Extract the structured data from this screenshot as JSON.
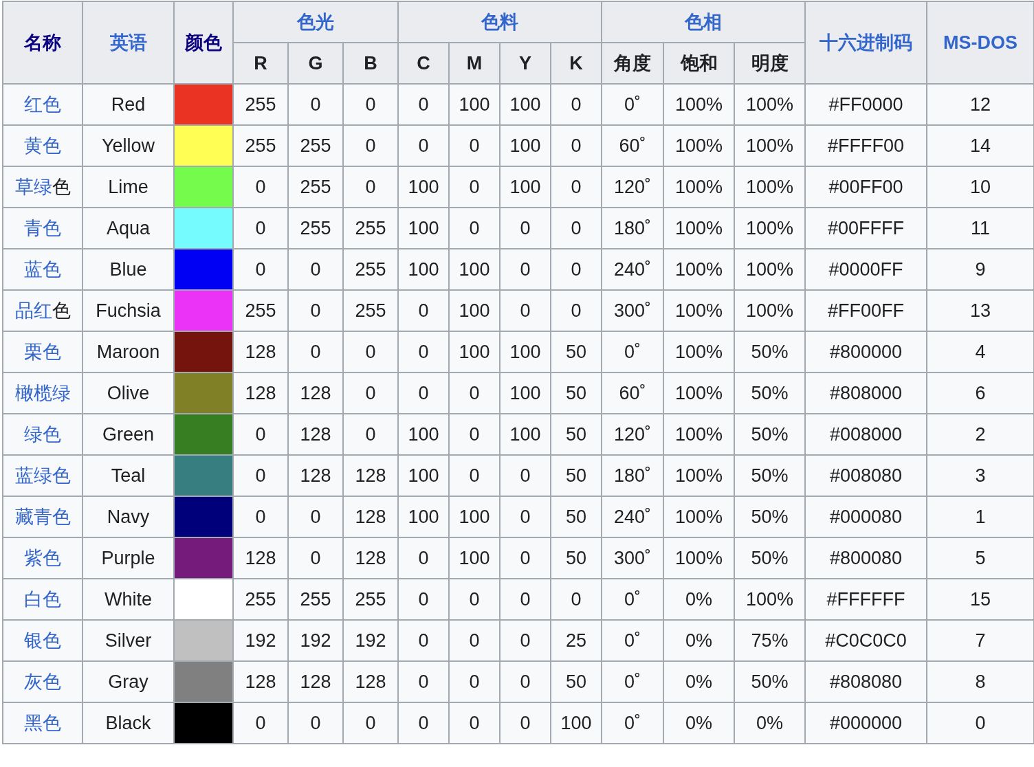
{
  "table": {
    "lead_columns": [
      {
        "label": "名称",
        "visited": true
      },
      {
        "label": "英语",
        "visited": false
      },
      {
        "label": "颜色",
        "visited": true
      }
    ],
    "groups": [
      {
        "label": "色光",
        "visited": false,
        "columns": [
          "R",
          "G",
          "B"
        ]
      },
      {
        "label": "色料",
        "visited": false,
        "columns": [
          "C",
          "M",
          "Y",
          "K"
        ]
      },
      {
        "label": "色相",
        "visited": false,
        "columns": [
          "角度",
          "饱和",
          "明度"
        ]
      }
    ],
    "trail_columns": [
      {
        "label": "十六进制码",
        "visited": false
      },
      {
        "label": "MS-DOS",
        "visited": false
      }
    ],
    "rows": [
      {
        "name_link": "红色",
        "english": "Red",
        "color": "#ea3323",
        "values": [
          "255",
          "0",
          "0",
          "0",
          "100",
          "100",
          "0",
          "0˚",
          "100%",
          "100%",
          "#FF0000",
          "12"
        ]
      },
      {
        "name_link": "黄色",
        "english": "Yellow",
        "color": "#fffe54",
        "values": [
          "255",
          "255",
          "0",
          "0",
          "0",
          "100",
          "0",
          "60˚",
          "100%",
          "100%",
          "#FFFF00",
          "14"
        ]
      },
      {
        "name_link": "草绿",
        "name_suffix": "色",
        "english": "Lime",
        "color": "#75fb4c",
        "values": [
          "0",
          "255",
          "0",
          "100",
          "0",
          "100",
          "0",
          "120˚",
          "100%",
          "100%",
          "#00FF00",
          "10"
        ]
      },
      {
        "name_link": "青色",
        "english": "Aqua",
        "color": "#75fbfd",
        "values": [
          "0",
          "255",
          "255",
          "100",
          "0",
          "0",
          "0",
          "180˚",
          "100%",
          "100%",
          "#00FFFF",
          "11"
        ]
      },
      {
        "name_link": "蓝色",
        "english": "Blue",
        "color": "#0000f5",
        "values": [
          "0",
          "0",
          "255",
          "100",
          "100",
          "0",
          "0",
          "240˚",
          "100%",
          "100%",
          "#0000FF",
          "9"
        ]
      },
      {
        "name_link": "品红",
        "name_suffix": "色",
        "english": "Fuchsia",
        "color": "#ea33f7",
        "values": [
          "255",
          "0",
          "255",
          "0",
          "100",
          "0",
          "0",
          "300˚",
          "100%",
          "100%",
          "#FF00FF",
          "13"
        ]
      },
      {
        "name_link": "栗色",
        "english": "Maroon",
        "color": "#75140c",
        "values": [
          "128",
          "0",
          "0",
          "0",
          "100",
          "100",
          "50",
          "0˚",
          "100%",
          "50%",
          "#800000",
          "4"
        ]
      },
      {
        "name_link": "橄榄绿",
        "english": "Olive",
        "color": "#808026",
        "values": [
          "128",
          "128",
          "0",
          "0",
          "0",
          "100",
          "50",
          "60˚",
          "100%",
          "50%",
          "#808000",
          "6"
        ]
      },
      {
        "name_link": "绿色",
        "english": "Green",
        "color": "#377d22",
        "values": [
          "0",
          "128",
          "0",
          "100",
          "0",
          "100",
          "50",
          "120˚",
          "100%",
          "50%",
          "#008000",
          "2"
        ]
      },
      {
        "name_link": "蓝绿色",
        "english": "Teal",
        "color": "#367e7f",
        "values": [
          "0",
          "128",
          "128",
          "100",
          "0",
          "0",
          "50",
          "180˚",
          "100%",
          "50%",
          "#008080",
          "3"
        ]
      },
      {
        "name_link": "藏青色",
        "english": "Navy",
        "color": "#00007b",
        "values": [
          "0",
          "0",
          "128",
          "100",
          "100",
          "0",
          "50",
          "240˚",
          "100%",
          "50%",
          "#000080",
          "1"
        ]
      },
      {
        "name_link": "紫色",
        "english": "Purple",
        "color": "#741b7c",
        "values": [
          "128",
          "0",
          "128",
          "0",
          "100",
          "0",
          "50",
          "300˚",
          "100%",
          "50%",
          "#800080",
          "5"
        ]
      },
      {
        "name_link": "白色",
        "english": "White",
        "color": "#ffffff",
        "values": [
          "255",
          "255",
          "255",
          "0",
          "0",
          "0",
          "0",
          "0˚",
          "0%",
          "100%",
          "#FFFFFF",
          "15"
        ]
      },
      {
        "name_link": "银色",
        "english": "Silver",
        "color": "#c0c0c0",
        "values": [
          "192",
          "192",
          "192",
          "0",
          "0",
          "0",
          "25",
          "0˚",
          "0%",
          "75%",
          "#C0C0C0",
          "7"
        ]
      },
      {
        "name_link": "灰色",
        "english": "Gray",
        "color": "#808080",
        "values": [
          "128",
          "128",
          "128",
          "0",
          "0",
          "0",
          "50",
          "0˚",
          "0%",
          "50%",
          "#808080",
          "8"
        ]
      },
      {
        "name_link": "黑色",
        "english": "Black",
        "color": "#000000",
        "values": [
          "0",
          "0",
          "0",
          "0",
          "0",
          "0",
          "100",
          "0˚",
          "0%",
          "0%",
          "#000000",
          "0"
        ]
      }
    ]
  }
}
